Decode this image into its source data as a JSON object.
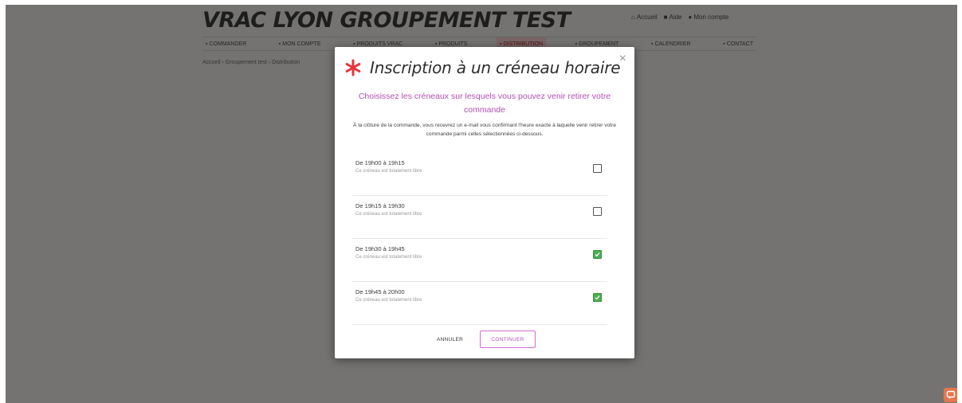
{
  "site": {
    "title": "VRAC LYON GROUPEMENT TEST",
    "top_links": [
      {
        "icon": "lock-icon",
        "label": "Accueil"
      },
      {
        "icon": "user-icon",
        "label": "Aide"
      },
      {
        "icon": "person-icon",
        "label": "Mon compte"
      }
    ]
  },
  "nav": {
    "items": [
      {
        "label": "Commander",
        "active": false
      },
      {
        "label": "Mon compte",
        "active": false
      },
      {
        "label": "Produits vrac",
        "active": false
      },
      {
        "label": "Produits",
        "active": false
      },
      {
        "label": "Distribution",
        "active": true
      },
      {
        "label": "Groupement",
        "active": false
      },
      {
        "label": "Calendrier",
        "active": false
      },
      {
        "label": "Contact",
        "active": false
      }
    ]
  },
  "breadcrumb": "Accueil › Groupement test › Distribution",
  "modal": {
    "title": "Inscription à un créneau horaire",
    "close_label": "×",
    "subtitle": "Choisissez les créneaux sur lesquels vous pouvez venir retirer votre commande",
    "description": "À la clôture de la commande, vous recevrez un e-mail vous confirmant l'heure exacte à laquelle venir retirer votre commande parmi celles sélectionnées ci-dessous.",
    "slots": [
      {
        "time": "De 19h00 à 19h15",
        "desc": "Ce créneau est totalement libre",
        "checked": false
      },
      {
        "time": "De 19h15 à 19h30",
        "desc": "Ce créneau est totalement libre",
        "checked": false
      },
      {
        "time": "De 19h30 à 19h45",
        "desc": "Ce créneau est totalement libre",
        "checked": true
      },
      {
        "time": "De 19h45 à 20h00",
        "desc": "Ce créneau est totalement libre",
        "checked": true
      }
    ],
    "cancel_label": "ANNULER",
    "continue_label": "CONTINUER"
  },
  "colors": {
    "accent": "#b34fb3",
    "brand_red": "#e8333a",
    "checked": "#4caf50",
    "help_button": "#e7764d"
  }
}
